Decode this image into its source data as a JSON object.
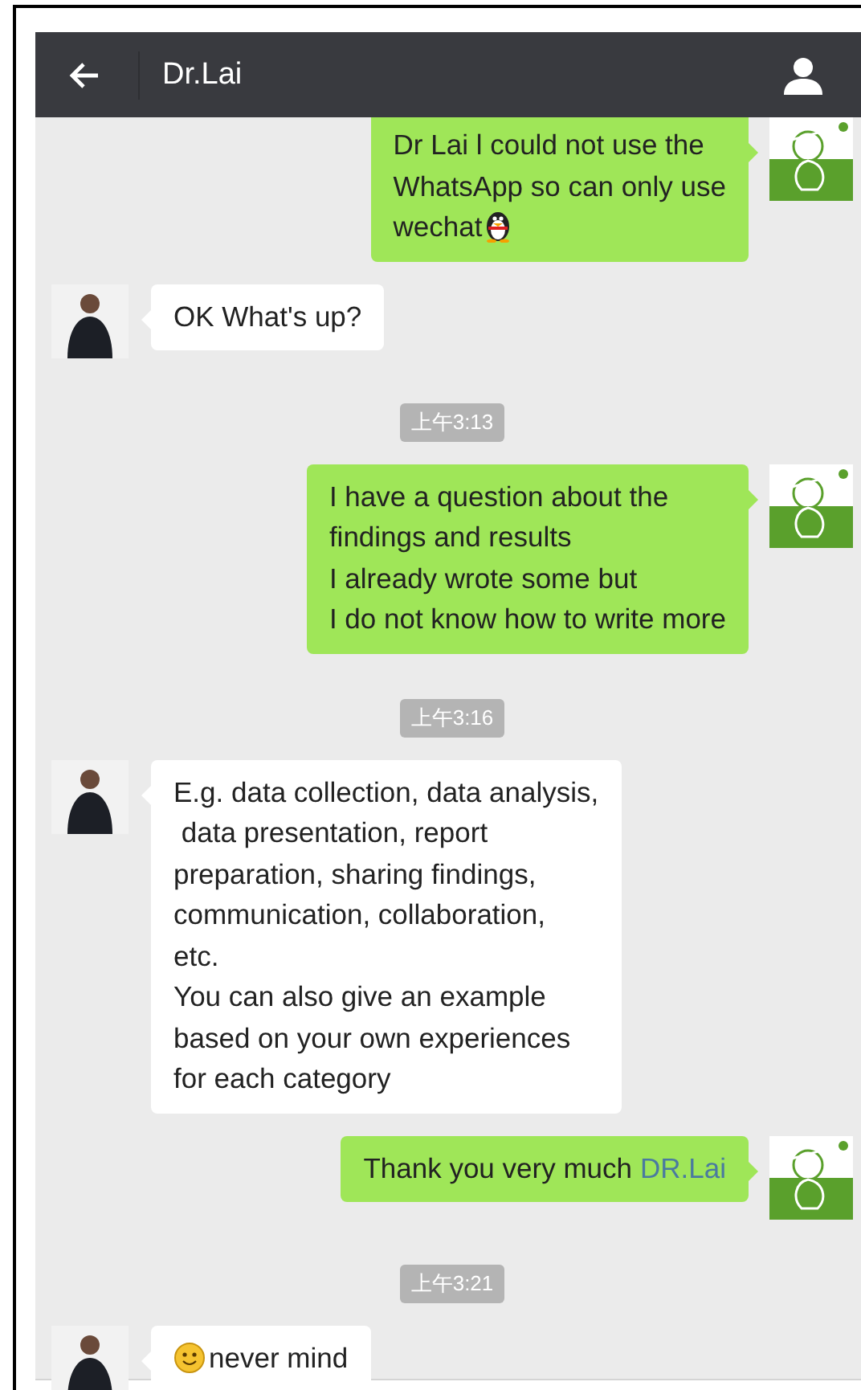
{
  "header": {
    "title": "Dr.Lai"
  },
  "messages": [
    {
      "kind": "sent",
      "text": "Dr Lai l could not use the\nWhatsApp so can only use\nwechat",
      "trailing_icon": true
    },
    {
      "kind": "received",
      "text": "OK What's up?"
    },
    {
      "kind": "time",
      "text": "上午3:13"
    },
    {
      "kind": "sent",
      "text": "I have a question about the\nfindings and results\nI already wrote some but\nI do not know how to write more"
    },
    {
      "kind": "time",
      "text": "上午3:16"
    },
    {
      "kind": "received",
      "text": "E.g. data collection, data analysis,\n data presentation, report\npreparation, sharing findings,\ncommunication, collaboration,\netc.\nYou can also give an example\nbased on your own experiences\nfor each category"
    },
    {
      "kind": "sent",
      "text": "Thank you very much",
      "mention": "DR.Lai"
    },
    {
      "kind": "time",
      "text": "上午3:21"
    },
    {
      "kind": "received",
      "text": "never mind",
      "leading_icon": true
    }
  ]
}
